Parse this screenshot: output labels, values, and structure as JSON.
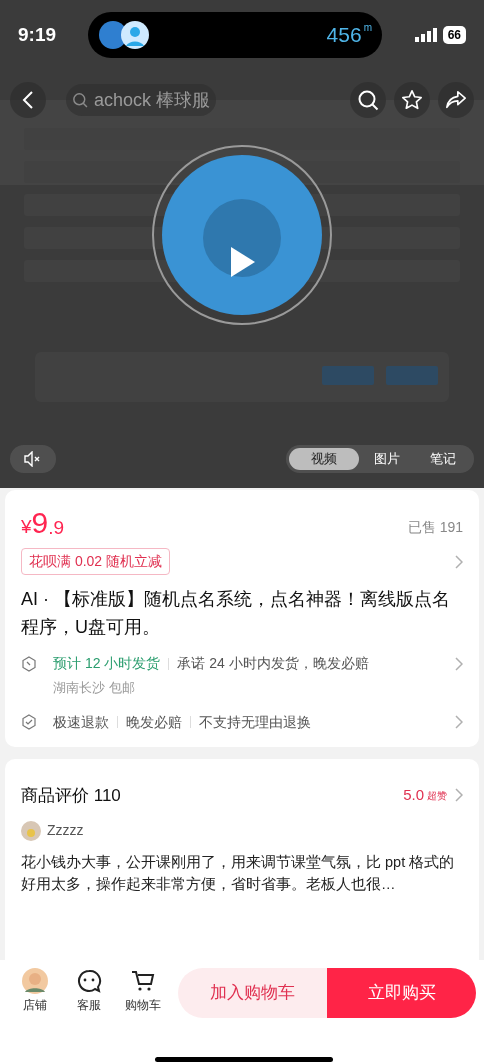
{
  "status_bar": {
    "time": "9:19",
    "distance": "456",
    "distance_unit": "m",
    "battery": "66"
  },
  "header": {
    "search_placeholder": "achock 棒球服"
  },
  "media": {
    "muted": true,
    "tabs": [
      {
        "label": "视频",
        "selected": true
      },
      {
        "label": "图片",
        "selected": false
      },
      {
        "label": "笔记",
        "selected": false
      }
    ]
  },
  "price": {
    "currency": "¥",
    "integer": "9",
    "decimal": ".9",
    "sold": "已售 191"
  },
  "promo": "花呗满 0.02 随机立减",
  "title": "AI · 【标准版】随机点名系统，点名神器！离线版点名程序，U盘可用。",
  "shipping": {
    "estimate": "预计 12 小时发货",
    "promise": "承诺 24 小时内发货，晚发必赔",
    "origin": "湖南长沙 包邮"
  },
  "guarantees": [
    "极速退款",
    "晚发必赔",
    "不支持无理由退换"
  ],
  "reviews": {
    "title": "商品评价 110",
    "score": "5.0",
    "score_label": "超赞",
    "user": "Zzzzz",
    "text": "花小钱办大事，公开课刚用了，用来调节课堂气氛，比 ppt 格式的好用太多，操作起来非常方便，省时省事。老板人也很…"
  },
  "bottom_bar": {
    "items": [
      {
        "kind": "shop",
        "label": "店铺"
      },
      {
        "kind": "service",
        "label": "客服"
      },
      {
        "kind": "cart",
        "label": "购物车"
      }
    ],
    "add_to_cart": "加入购物车",
    "buy_now": "立即购买"
  }
}
